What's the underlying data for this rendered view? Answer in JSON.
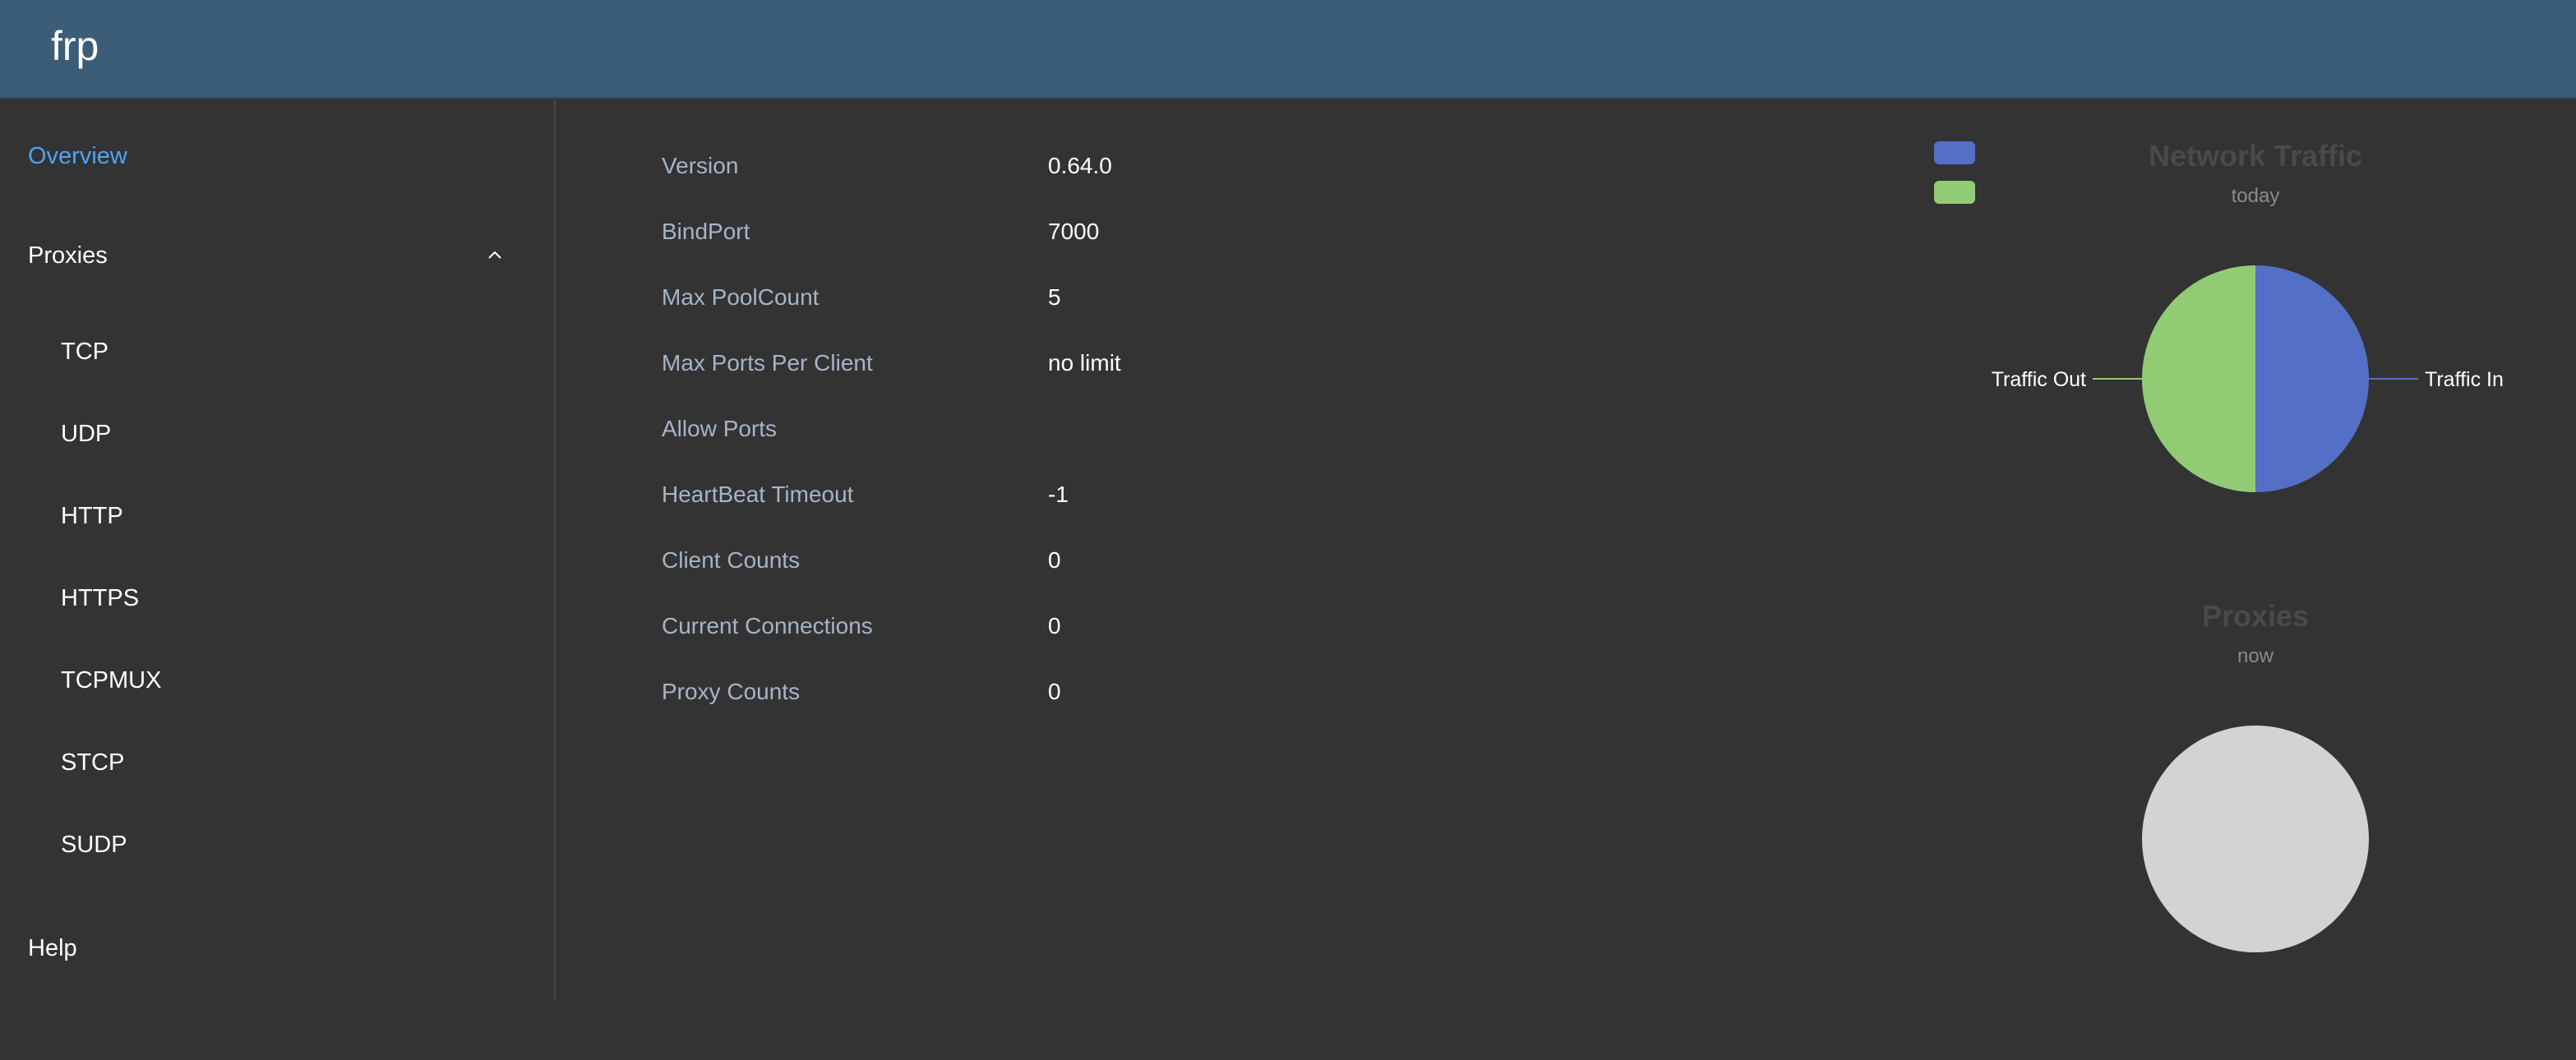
{
  "header": {
    "brand": "frp"
  },
  "sidebar": {
    "overview": "Overview",
    "proxies": "Proxies",
    "proxy_types": [
      "TCP",
      "UDP",
      "HTTP",
      "HTTPS",
      "TCPMUX",
      "STCP",
      "SUDP"
    ],
    "help": "Help"
  },
  "server_info": [
    {
      "label": "Version",
      "value": "0.64.0"
    },
    {
      "label": "BindPort",
      "value": "7000"
    },
    {
      "label": "Max PoolCount",
      "value": "5"
    },
    {
      "label": "Max Ports Per Client",
      "value": "no limit"
    },
    {
      "label": "Allow Ports",
      "value": ""
    },
    {
      "label": "HeartBeat Timeout",
      "value": "-1"
    },
    {
      "label": "Client Counts",
      "value": "0"
    },
    {
      "label": "Current Connections",
      "value": "0"
    },
    {
      "label": "Proxy Counts",
      "value": "0"
    }
  ],
  "colors": {
    "header_bg": "#3c5d77",
    "page_bg": "#333333",
    "active_nav": "#4fa3f7",
    "traffic_in": "#5470c6",
    "traffic_out": "#91cc75",
    "empty_pie": "#d3d3d3"
  },
  "chart_data": [
    {
      "type": "pie",
      "title": "Network Traffic",
      "subtitle": "today",
      "legend_position": "top-left",
      "slices": [
        {
          "label": "Traffic In",
          "value": 50,
          "color": "#5470c6"
        },
        {
          "label": "Traffic Out",
          "value": 50,
          "color": "#91cc75"
        }
      ]
    },
    {
      "type": "pie",
      "title": "Proxies",
      "subtitle": "now",
      "slices": []
    }
  ]
}
